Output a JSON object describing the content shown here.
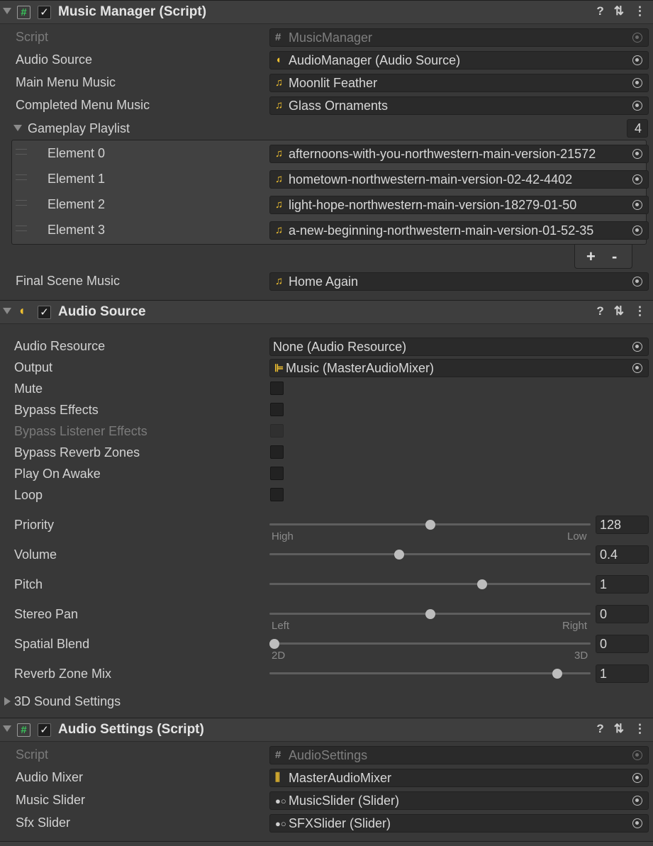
{
  "music_manager": {
    "title": "Music Manager (Script)",
    "script_label": "Script",
    "script_value": "MusicManager",
    "audio_source_label": "Audio Source",
    "audio_source_value": "AudioManager (Audio Source)",
    "main_menu_label": "Main Menu Music",
    "main_menu_value": "Moonlit Feather",
    "completed_menu_label": "Completed Menu Music",
    "completed_menu_value": "Glass Ornaments",
    "playlist_label": "Gameplay Playlist",
    "playlist_count": "4",
    "playlist": [
      {
        "label": "Element 0",
        "value": "afternoons-with-you-northwestern-main-version-21572"
      },
      {
        "label": "Element 1",
        "value": "hometown-northwestern-main-version-02-42-4402"
      },
      {
        "label": "Element 2",
        "value": "light-hope-northwestern-main-version-18279-01-50"
      },
      {
        "label": "Element 3",
        "value": "a-new-beginning-northwestern-main-version-01-52-35"
      }
    ],
    "add_label": "+",
    "remove_label": "-",
    "final_scene_label": "Final Scene Music",
    "final_scene_value": "Home Again"
  },
  "audio_source": {
    "title": "Audio Source",
    "resource_label": "Audio Resource",
    "resource_value": "None (Audio Resource)",
    "output_label": "Output",
    "output_value": "Music (MasterAudioMixer)",
    "mute_label": "Mute",
    "bypass_effects_label": "Bypass Effects",
    "bypass_listener_label": "Bypass Listener Effects",
    "bypass_reverb_label": "Bypass Reverb Zones",
    "play_on_awake_label": "Play On Awake",
    "loop_label": "Loop",
    "priority_label": "Priority",
    "priority_value": "128",
    "priority_fraction": 0.5,
    "priority_min_label": "High",
    "priority_max_label": "Low",
    "volume_label": "Volume",
    "volume_value": "0.4",
    "volume_fraction": 0.4,
    "pitch_label": "Pitch",
    "pitch_value": "1",
    "pitch_fraction": 0.667,
    "stereo_pan_label": "Stereo Pan",
    "stereo_pan_value": "0",
    "stereo_pan_fraction": 0.5,
    "stereo_min_label": "Left",
    "stereo_max_label": "Right",
    "spatial_blend_label": "Spatial Blend",
    "spatial_blend_value": "0",
    "spatial_blend_fraction": 0.0,
    "spatial_min_label": "2D",
    "spatial_max_label": "3D",
    "reverb_mix_label": "Reverb Zone Mix",
    "reverb_mix_value": "1",
    "reverb_mix_fraction": 0.909,
    "sound_settings_label": "3D Sound Settings"
  },
  "audio_settings": {
    "title": "Audio Settings (Script)",
    "script_label": "Script",
    "script_value": "AudioSettings",
    "mixer_label": "Audio Mixer",
    "mixer_value": "MasterAudioMixer",
    "music_slider_label": "Music Slider",
    "music_slider_value": "MusicSlider (Slider)",
    "sfx_slider_label": "Sfx Slider",
    "sfx_slider_value": "SFXSlider (Slider)"
  },
  "header_icons": {
    "help": "?",
    "presets": "⫶",
    "menu": "⋮"
  },
  "icons": {
    "script": "hash-icon",
    "audio_clip": "music-note-icon",
    "audio_source": "speaker-icon",
    "mixer": "mixer-icon",
    "slider": "slider-icon",
    "picker": "object-picker-icon"
  }
}
